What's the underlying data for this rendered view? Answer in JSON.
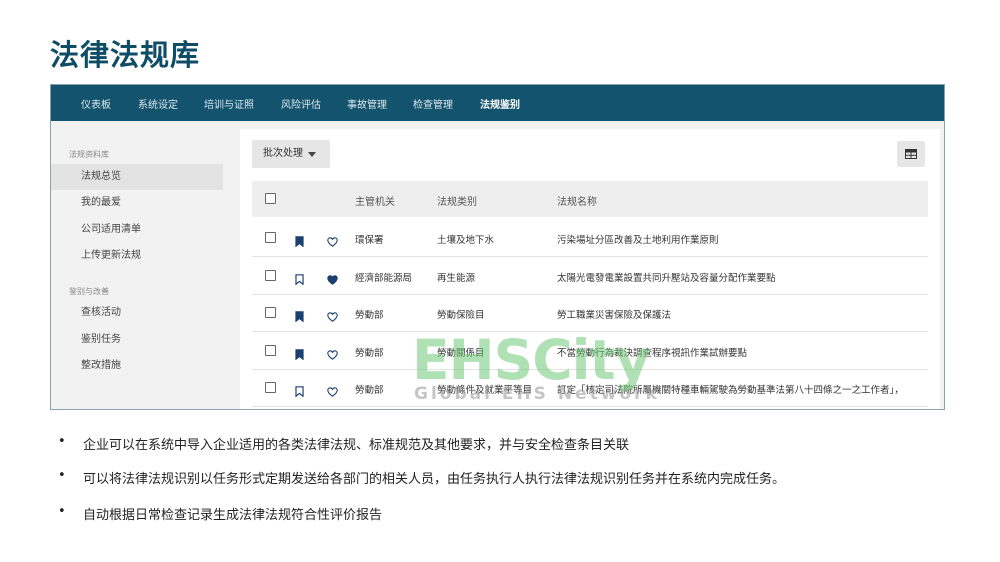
{
  "slide": {
    "title": "法律法规库",
    "bullets": [
      "企业可以在系统中导入企业适用的各类法律法规、标准规范及其他要求，并与安全检查条目关联",
      "可以将法律法规识别以任务形式定期发送给各部门的相关人员，由任务执行人执行法律法规识别任务并在系统内完成任务。",
      "自动根据日常检查记录生成法律法规符合性评价报告"
    ],
    "bullet_symbol": "•"
  },
  "nav": {
    "items": [
      "仪表板",
      "系统设定",
      "培训与证照",
      "风险评估",
      "事故管理",
      "检查管理",
      "法规鉴别"
    ],
    "active": "法规鉴别"
  },
  "sidebar": {
    "group1_title": "法规资料库",
    "group1_items": [
      "法规总览",
      "我的最爱",
      "公司适用清单",
      "上传更新法规"
    ],
    "group2_title": "鉴别与改善",
    "group2_items": [
      "查核活动",
      "鉴别任务",
      "整改措施"
    ],
    "active_item": "法规总览"
  },
  "toolbar": {
    "batch_label": "批次处理",
    "view_icon": "table-view-icon"
  },
  "table": {
    "headers": [
      "主管机关",
      "法规类别",
      "法规名称"
    ],
    "rows": [
      {
        "bookmarked": true,
        "favorite": false,
        "authority": "環保署",
        "category": "土壤及地下水",
        "name": "污染場址分區改善及土地利用作業原則"
      },
      {
        "bookmarked": false,
        "favorite": true,
        "authority": "經濟部能源局",
        "category": "再生能源",
        "name": "太陽光電發電業設置共同升壓站及容量分配作業要點"
      },
      {
        "bookmarked": true,
        "favorite": false,
        "authority": "勞動部",
        "category": "勞動保險目",
        "name": "勞工職業災害保險及保護法"
      },
      {
        "bookmarked": true,
        "favorite": false,
        "authority": "勞動部",
        "category": "勞動關係目",
        "name": "不當勞動行為裁決調查程序視訊作業試辦要點"
      },
      {
        "bookmarked": false,
        "favorite": false,
        "authority": "勞動部",
        "category": "勞動條件及就業平等目",
        "name": "訂定「核定司法院所屬機關特種車輛駕駛為勞動基準法第八十四條之一之工作者」，"
      }
    ]
  },
  "watermark": {
    "main": "EHSCity",
    "sub": "Global EHS Network"
  },
  "colors": {
    "title": "#0f4d67",
    "nav_bg": "#14536e",
    "icon": "#1b3f6e"
  }
}
